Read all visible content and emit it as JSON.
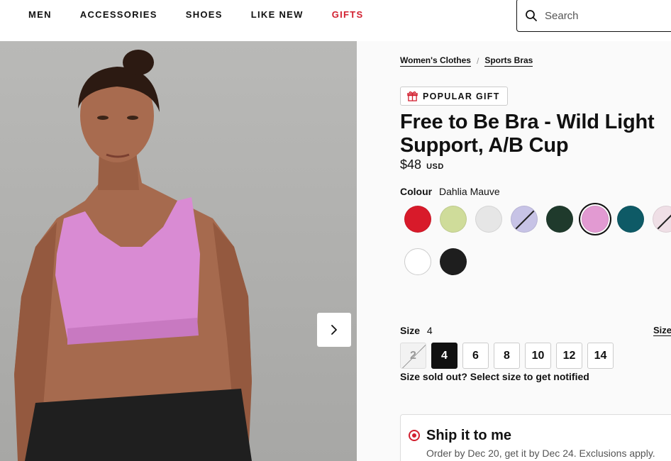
{
  "nav": {
    "links": [
      "MEN",
      "ACCESSORIES",
      "SHOES",
      "LIKE NEW",
      "GIFTS"
    ],
    "highlight_color": "#d22030"
  },
  "search": {
    "placeholder": "Search"
  },
  "breadcrumb": [
    "Women's Clothes",
    "Sports Bras"
  ],
  "badge": {
    "icon": "gift-icon",
    "label": "POPULAR GIFT"
  },
  "product": {
    "title": "Free to Be Bra - Wild Light Support, A/B Cup",
    "price": "$48",
    "currency": "USD"
  },
  "colour": {
    "label": "Colour",
    "selected": "Dahlia Mauve",
    "swatches": [
      {
        "color": "#d81a2a",
        "unavailable": false,
        "selected": false
      },
      {
        "color": "#cfdc9a",
        "unavailable": false,
        "selected": false
      },
      {
        "color": "#e6e6e6",
        "unavailable": false,
        "selected": false
      },
      {
        "color": "#c7c3e6",
        "unavailable": true,
        "selected": false
      },
      {
        "color": "#1f3a2c",
        "unavailable": false,
        "selected": false
      },
      {
        "color": "#e29ad2",
        "unavailable": false,
        "selected": true
      },
      {
        "color": "#0e5a66",
        "unavailable": false,
        "selected": false
      },
      {
        "color": "#efdfe6",
        "unavailable": true,
        "selected": false
      },
      {
        "color": "#ffffff",
        "unavailable": false,
        "selected": false
      },
      {
        "color": "#1e1e1e",
        "unavailable": false,
        "selected": false
      }
    ]
  },
  "size": {
    "label": "Size",
    "selected": "4",
    "guide_label": "Size",
    "options": [
      {
        "label": "2",
        "soldout": true
      },
      {
        "label": "4",
        "selected": true
      },
      {
        "label": "6"
      },
      {
        "label": "8"
      },
      {
        "label": "10"
      },
      {
        "label": "12"
      },
      {
        "label": "14"
      }
    ],
    "sold_note": "Size sold out? Select size to get notified"
  },
  "shipping": {
    "title": "Ship it to me",
    "subtitle": "Order by Dec 20, get it by Dec 24. Exclusions apply."
  }
}
